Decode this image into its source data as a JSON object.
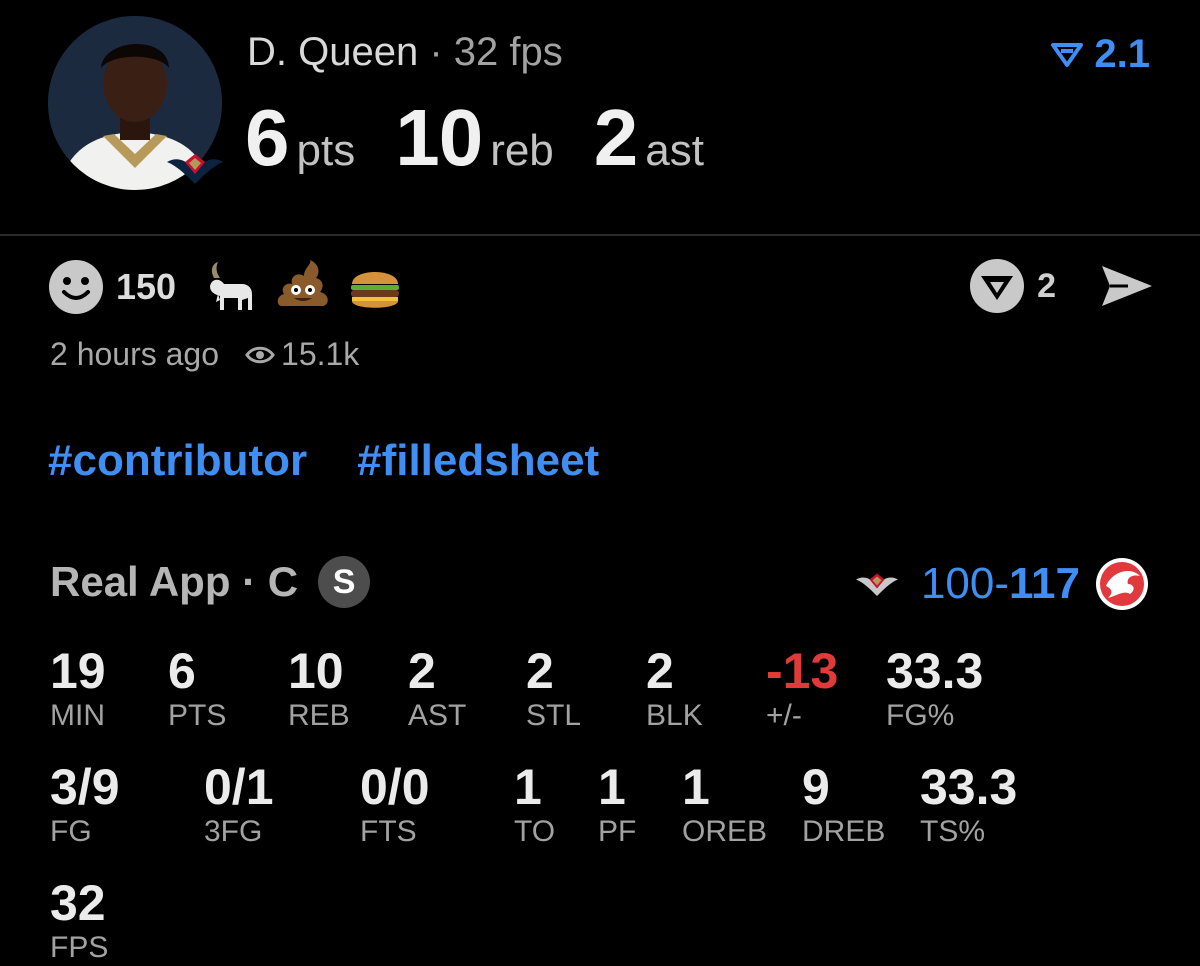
{
  "header": {
    "player_name": "D. Queen",
    "separator": "·",
    "fps_text": "32 fps",
    "big_stats": [
      {
        "value": "6",
        "label": "pts"
      },
      {
        "value": "10",
        "label": "reb"
      },
      {
        "value": "2",
        "label": "ast"
      }
    ],
    "rating_value": "2.1"
  },
  "reactions": {
    "count": "150",
    "emojis": [
      "goat-icon",
      "poop-icon",
      "burger-icon"
    ],
    "share_count": "2",
    "posted": "2 hours ago",
    "views": "15.1k"
  },
  "tags": [
    "#contributor",
    "#filledsheet"
  ],
  "game": {
    "app_label": "Real App · C",
    "badge": "S",
    "score_ours": "100",
    "score_dash": "-",
    "score_theirs": "117"
  },
  "stats": [
    {
      "value": "19",
      "label": "MIN"
    },
    {
      "value": "6",
      "label": "PTS"
    },
    {
      "value": "10",
      "label": "REB"
    },
    {
      "value": "2",
      "label": "AST"
    },
    {
      "value": "2",
      "label": "STL"
    },
    {
      "value": "2",
      "label": "BLK"
    },
    {
      "value": "-13",
      "label": "+/-"
    },
    {
      "value": "33.3",
      "label": "FG%"
    },
    {
      "value": "3/9",
      "label": "FG"
    },
    {
      "value": "0/1",
      "label": "3FG"
    },
    {
      "value": "0/0",
      "label": "FTS"
    },
    {
      "value": "1",
      "label": "TO"
    },
    {
      "value": "1",
      "label": "PF"
    },
    {
      "value": "1",
      "label": "OREB"
    },
    {
      "value": "9",
      "label": "DREB"
    },
    {
      "value": "33.3",
      "label": "TS%"
    },
    {
      "value": "32",
      "label": "FPS"
    }
  ],
  "colors": {
    "accent": "#3f8ef3",
    "negative": "#e03a3a",
    "background": "#000000"
  }
}
